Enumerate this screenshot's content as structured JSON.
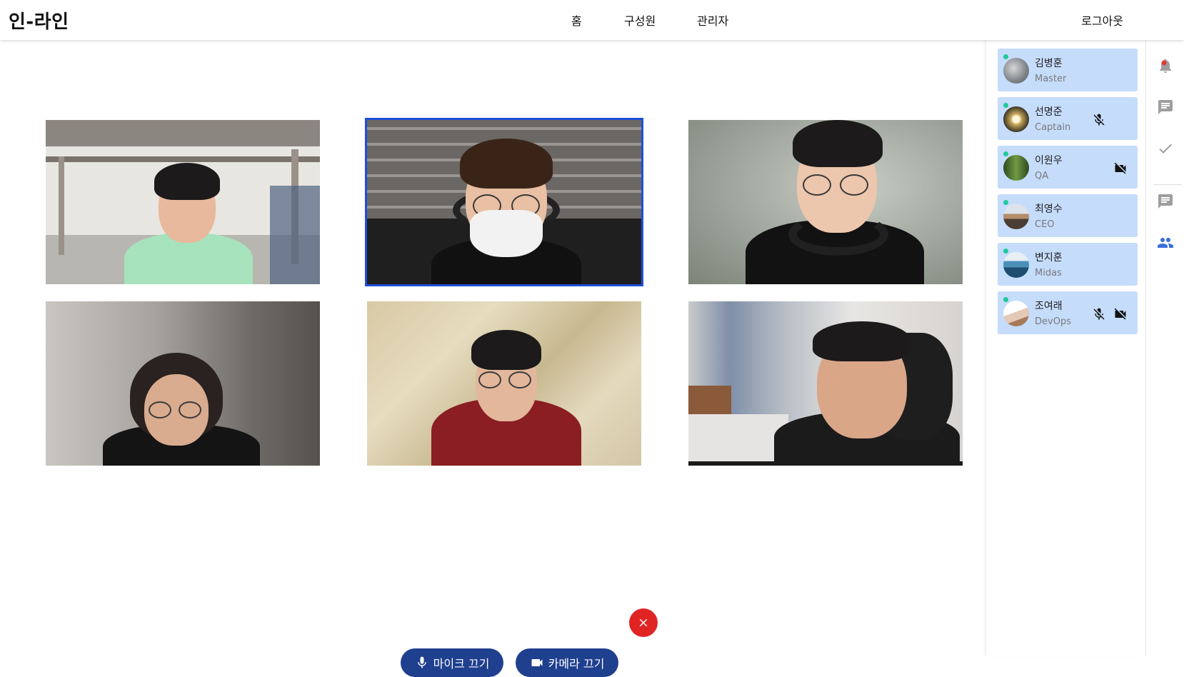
{
  "app": {
    "title": "인-라인"
  },
  "nav": {
    "items": [
      "홈",
      "구성원",
      "관리자"
    ],
    "logout": "로그아웃"
  },
  "participants": [
    {
      "name": "김병훈",
      "role": "Master",
      "online": true,
      "mic_muted": false,
      "cam_off": false
    },
    {
      "name": "선명준",
      "role": "Captain",
      "online": true,
      "mic_muted": true,
      "cam_off": false
    },
    {
      "name": "이원우",
      "role": "QA",
      "online": true,
      "mic_muted": false,
      "cam_off": true
    },
    {
      "name": "최영수",
      "role": "CEO",
      "online": true,
      "mic_muted": false,
      "cam_off": false
    },
    {
      "name": "변지훈",
      "role": "Midas",
      "online": true,
      "mic_muted": false,
      "cam_off": false
    },
    {
      "name": "조여래",
      "role": "DevOps",
      "online": true,
      "mic_muted": true,
      "cam_off": true
    }
  ],
  "controls": {
    "mic_label": "마이크 끄기",
    "camera_label": "카메라 끄기"
  },
  "video": {
    "active_index": 1
  },
  "colors": {
    "accent": "#1f3f8f",
    "active_border": "#1e4fd8",
    "card_bg": "#c5dcfb",
    "hangup": "#e02424",
    "online": "#20c997",
    "rail_active": "#3b6fd8"
  },
  "icons": {
    "rail": [
      "notification-bell-icon",
      "chat-icon",
      "check-icon",
      "message-icon",
      "people-icon"
    ],
    "mic_off": "mic-off-icon",
    "cam_off": "videocam-off-icon"
  }
}
